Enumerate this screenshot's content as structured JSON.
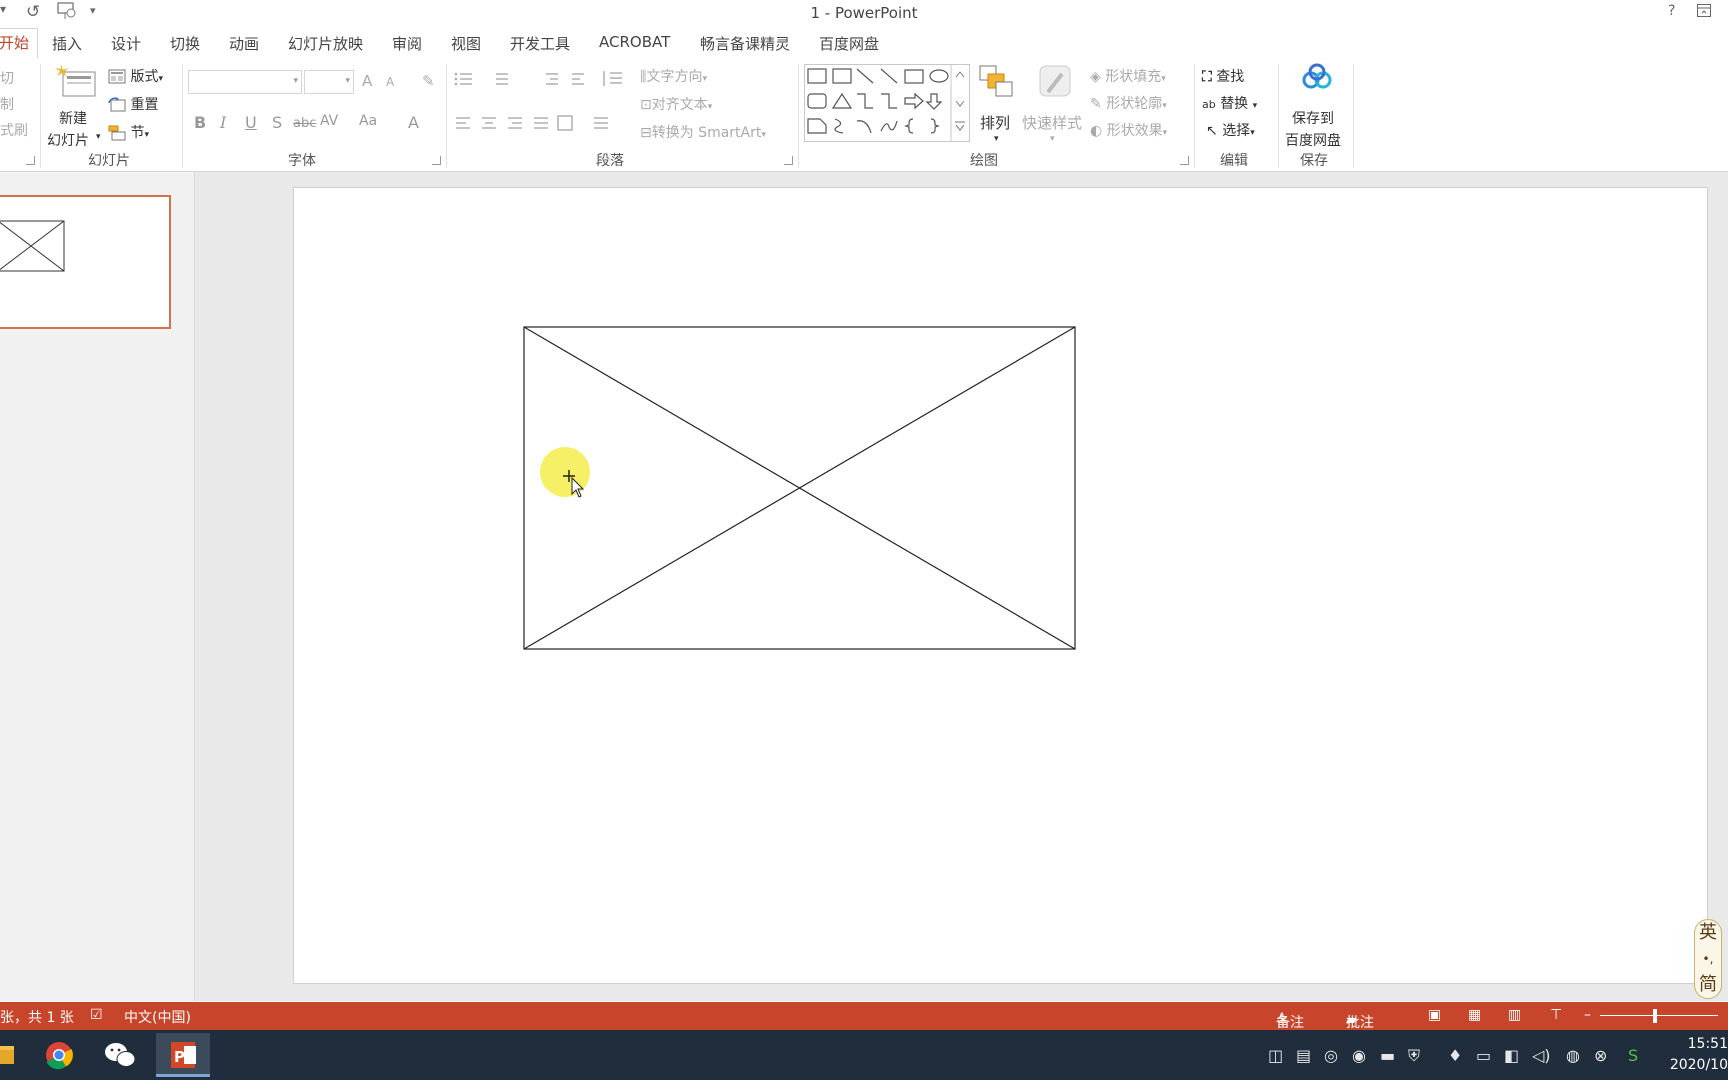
{
  "window": {
    "title": "1 - PowerPoint",
    "help": "?"
  },
  "tabs": [
    "开始",
    "插入",
    "设计",
    "切换",
    "动画",
    "幻灯片放映",
    "审阅",
    "视图",
    "开发工具",
    "ACROBAT",
    "畅言备课精灵",
    "百度网盘"
  ],
  "ribbon": {
    "clipboard": {
      "cut": "切",
      "copy": "制",
      "format_painter": "式刷"
    },
    "slides": {
      "new_slide_line1": "新建",
      "new_slide_line2": "幻灯片",
      "layout": "版式",
      "reset": "重置",
      "section": "节",
      "label": "幻灯片"
    },
    "font": {
      "label": "字体",
      "bold": "B",
      "italic": "I",
      "underline": "U",
      "shadow": "S",
      "strike": "abc",
      "spacing": "AV",
      "case": "Aa",
      "color": "A",
      "grow": "A",
      "shrink": "A"
    },
    "paragraph": {
      "label": "段落",
      "text_direction": "文字方向",
      "align_text": "对齐文本",
      "convert_smartart": "转换为 SmartArt"
    },
    "drawing": {
      "label": "绘图",
      "arrange": "排列",
      "quick_styles": "快速样式",
      "shape_fill": "形状填充",
      "shape_outline": "形状轮廓",
      "shape_effects": "形状效果"
    },
    "editing": {
      "label": "编辑",
      "find": "查找",
      "replace": "替换",
      "select": "选择"
    },
    "save": {
      "label": "保存",
      "btn_line1": "保存到",
      "btn_line2": "百度网盘"
    }
  },
  "status": {
    "slide_info": "张，共 1 张",
    "language": "中文(中国)",
    "notes": "备注",
    "comments": "批注"
  },
  "ime": {
    "chars": [
      "英",
      "•,",
      "简"
    ]
  },
  "taskbar": {
    "time": "15:51",
    "date": "2020/10"
  },
  "colors": {
    "accent": "#c7462b",
    "highlight": "#f5ee57",
    "taskbar": "#1f2d3d"
  }
}
